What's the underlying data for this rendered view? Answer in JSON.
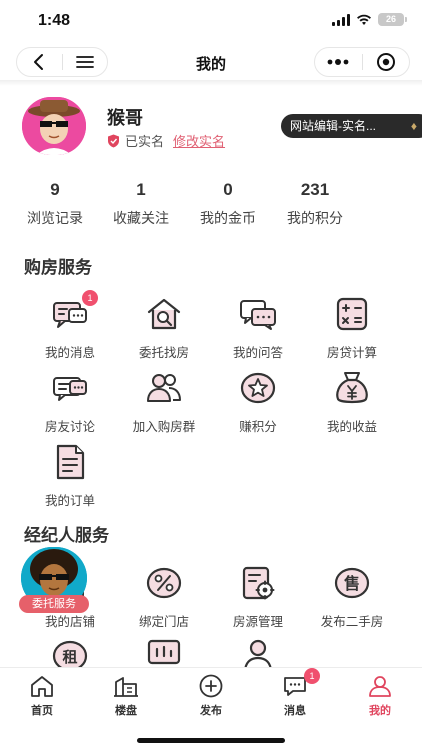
{
  "status_bar": {
    "time": "1:48",
    "battery": "26"
  },
  "nav": {
    "title": "我的"
  },
  "profile": {
    "username": "猴哥",
    "verified_label": "已实名",
    "modify_label": "修改实名",
    "tooltip_text": "网站编辑-实名..."
  },
  "stats": [
    {
      "value": "9",
      "label": "浏览记录"
    },
    {
      "value": "1",
      "label": "收藏关注"
    },
    {
      "value": "0",
      "label": "我的金币"
    },
    {
      "value": "231",
      "label": "我的积分"
    }
  ],
  "buy_service": {
    "title": "购房服务",
    "items": [
      {
        "label": "我的消息",
        "icon": "message-icon",
        "badge": "1"
      },
      {
        "label": "委托找房",
        "icon": "house-search-icon"
      },
      {
        "label": "我的问答",
        "icon": "qa-icon"
      },
      {
        "label": "房贷计算",
        "icon": "calculator-icon"
      },
      {
        "label": "房友讨论",
        "icon": "discussion-icon"
      },
      {
        "label": "加入购房群",
        "icon": "group-icon"
      },
      {
        "label": "赚积分",
        "icon": "star-icon"
      },
      {
        "label": "我的收益",
        "icon": "money-bag-icon"
      },
      {
        "label": "我的订单",
        "icon": "order-icon"
      }
    ]
  },
  "agent_service": {
    "title": "经纪人服务",
    "items": [
      {
        "label": "我的店铺",
        "icon": "shop-icon"
      },
      {
        "label": "绑定门店",
        "icon": "bind-store-icon"
      },
      {
        "label": "房源管理",
        "icon": "listing-manage-icon"
      },
      {
        "label": "发布二手房",
        "icon": "sell-icon"
      }
    ],
    "row3_icons": [
      "rent-icon",
      "chart-board-icon",
      "agent-person-icon"
    ]
  },
  "float_agent": {
    "tag": "委托服务"
  },
  "tabs": [
    {
      "label": "首页",
      "icon": "home-icon"
    },
    {
      "label": "楼盘",
      "icon": "building-icon"
    },
    {
      "label": "发布",
      "icon": "plus-circle-icon"
    },
    {
      "label": "消息",
      "icon": "chat-icon",
      "badge": "1"
    },
    {
      "label": "我的",
      "icon": "user-icon",
      "active": true
    }
  ],
  "colors": {
    "accent": "#e0455e",
    "icon_fill": "#f5dde2",
    "icon_stroke": "#333333"
  }
}
